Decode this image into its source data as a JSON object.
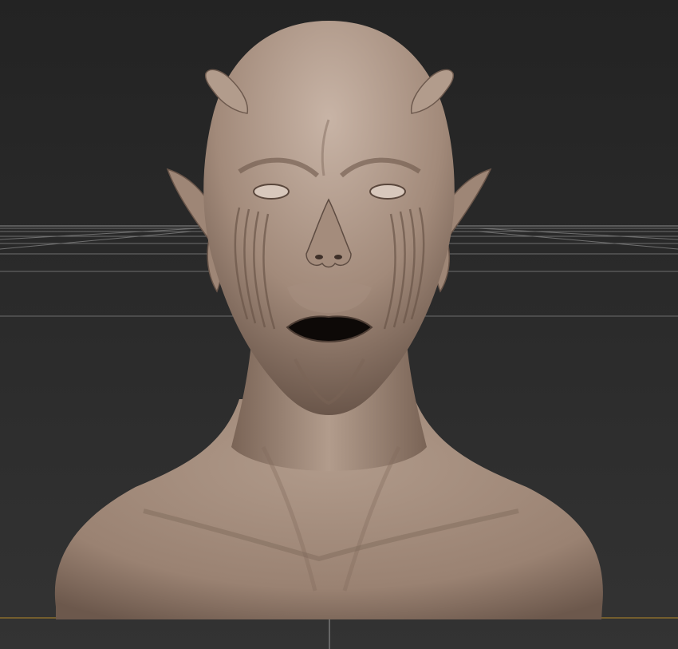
{
  "viewport": {
    "background_top": "#232323",
    "background_bottom": "#333333",
    "grid_color": "#6e6e6e",
    "horizon_color": "#8a8a8a",
    "axis_color": "#b58a2a"
  },
  "model": {
    "material_color": "#a08878",
    "material_highlight": "#c5b0a2",
    "material_shadow": "#5e4c42",
    "mouth_interior": "#0d0907"
  }
}
